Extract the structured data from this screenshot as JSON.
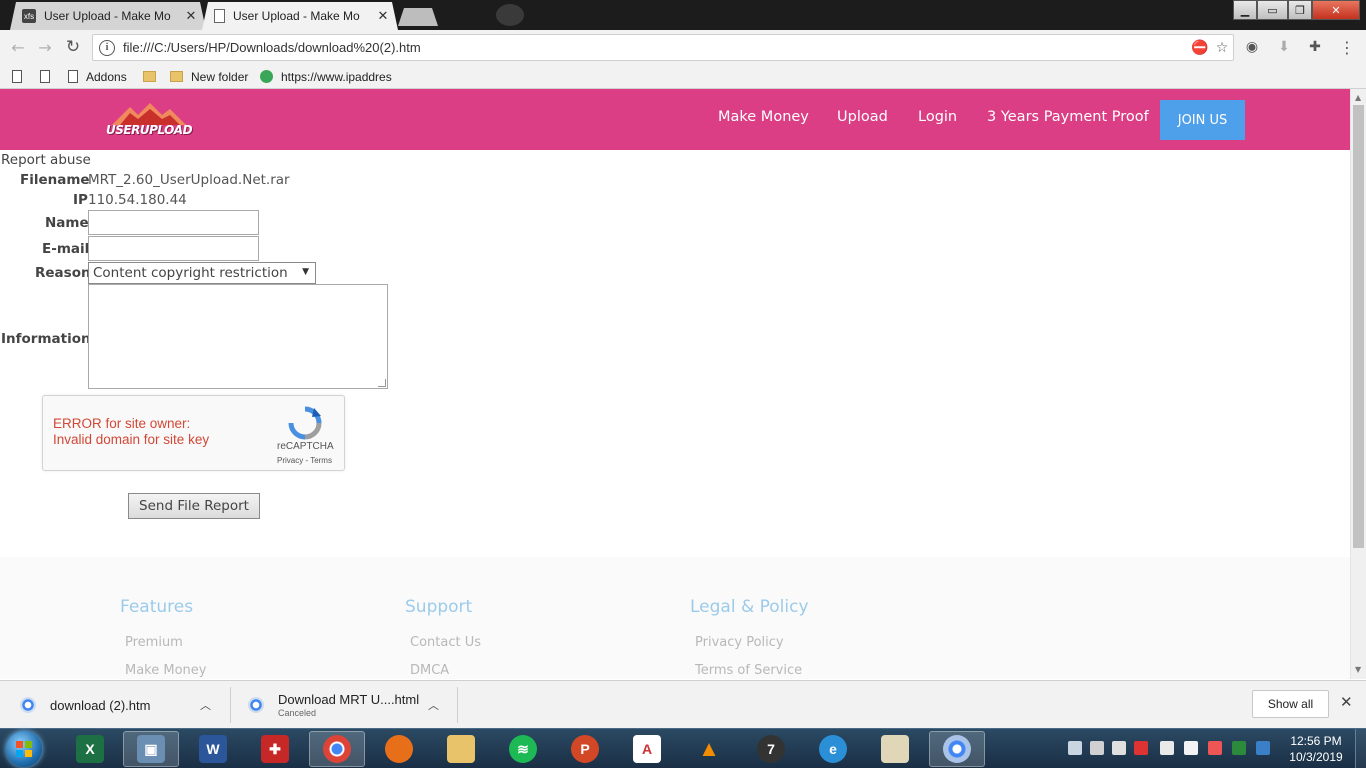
{
  "browser": {
    "tabs": [
      {
        "title": "User Upload - Make Mo",
        "favicon": "xfs",
        "active": false
      },
      {
        "title": "User Upload - Make Mo",
        "favicon": "page",
        "active": true
      }
    ],
    "xfs_label": "xfs",
    "url": "file:///C:/Users/HP/Downloads/download%20(2).htm",
    "bookmarks": [
      "Addons",
      "New folder",
      "https://www.ipaddres"
    ]
  },
  "site": {
    "logo_text": "USERUPLOAD",
    "menu": [
      "Make Money",
      "Upload",
      "Login",
      "3 Years Payment Proof"
    ],
    "join_label": "JOIN US",
    "brand_color": "#db3e84",
    "join_color": "#4fa0ea"
  },
  "form": {
    "title": "Report abuse",
    "filename_label": "Filename",
    "filename_value": "MRT_2.60_UserUpload.Net.rar",
    "ip_label": "IP",
    "ip_value": "110.54.180.44",
    "name_label": "Name",
    "email_label": "E-mail",
    "reason_label": "Reason",
    "reason_value": "Content copyright restriction",
    "information_label": "Information",
    "recaptcha": {
      "error_line1": "ERROR for site owner:",
      "error_line2": "Invalid domain for site key",
      "brand": "reCAPTCHA",
      "links": "Privacy - Terms"
    },
    "submit_label": "Send File Report"
  },
  "footer": {
    "columns": [
      {
        "heading": "Features",
        "links": [
          "Premium",
          "Make Money"
        ]
      },
      {
        "heading": "Support",
        "links": [
          "Contact Us",
          "DMCA"
        ]
      },
      {
        "heading": "Legal & Policy",
        "links": [
          "Privacy Policy",
          "Terms of Service"
        ]
      }
    ]
  },
  "downloads": {
    "items": [
      {
        "name": "download (2).htm",
        "status": ""
      },
      {
        "name": "Download MRT U....html",
        "status": "Canceled"
      }
    ],
    "show_all_label": "Show all"
  },
  "taskbar": {
    "time": "12:56 PM",
    "date": "10/3/2019"
  }
}
